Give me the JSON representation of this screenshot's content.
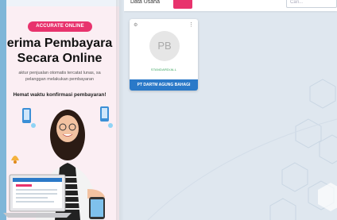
{
  "banner": {
    "pill_label": "ACCURATE ONLINE",
    "headline_line1": "erima Pembayara",
    "headline_line2": "Secara Online",
    "subtext_line1": "aktur penjualan otomatis tercatat lunas, sa",
    "subtext_line2": "pelanggan melakukan pembayaran",
    "tagline": "Hemat waktu konfirmasi pembayaran!"
  },
  "topbar": {
    "dataset_label": "Data Usaha",
    "search_placeholder": "Cari..."
  },
  "card": {
    "initials": "PB",
    "badge": "STANDARD/ALL",
    "company_name": "PT DARTM AGUNG BAHAGI"
  },
  "colors": {
    "accent": "#e8336d",
    "primary": "#2a79c8",
    "background": "#dfe7ef"
  }
}
